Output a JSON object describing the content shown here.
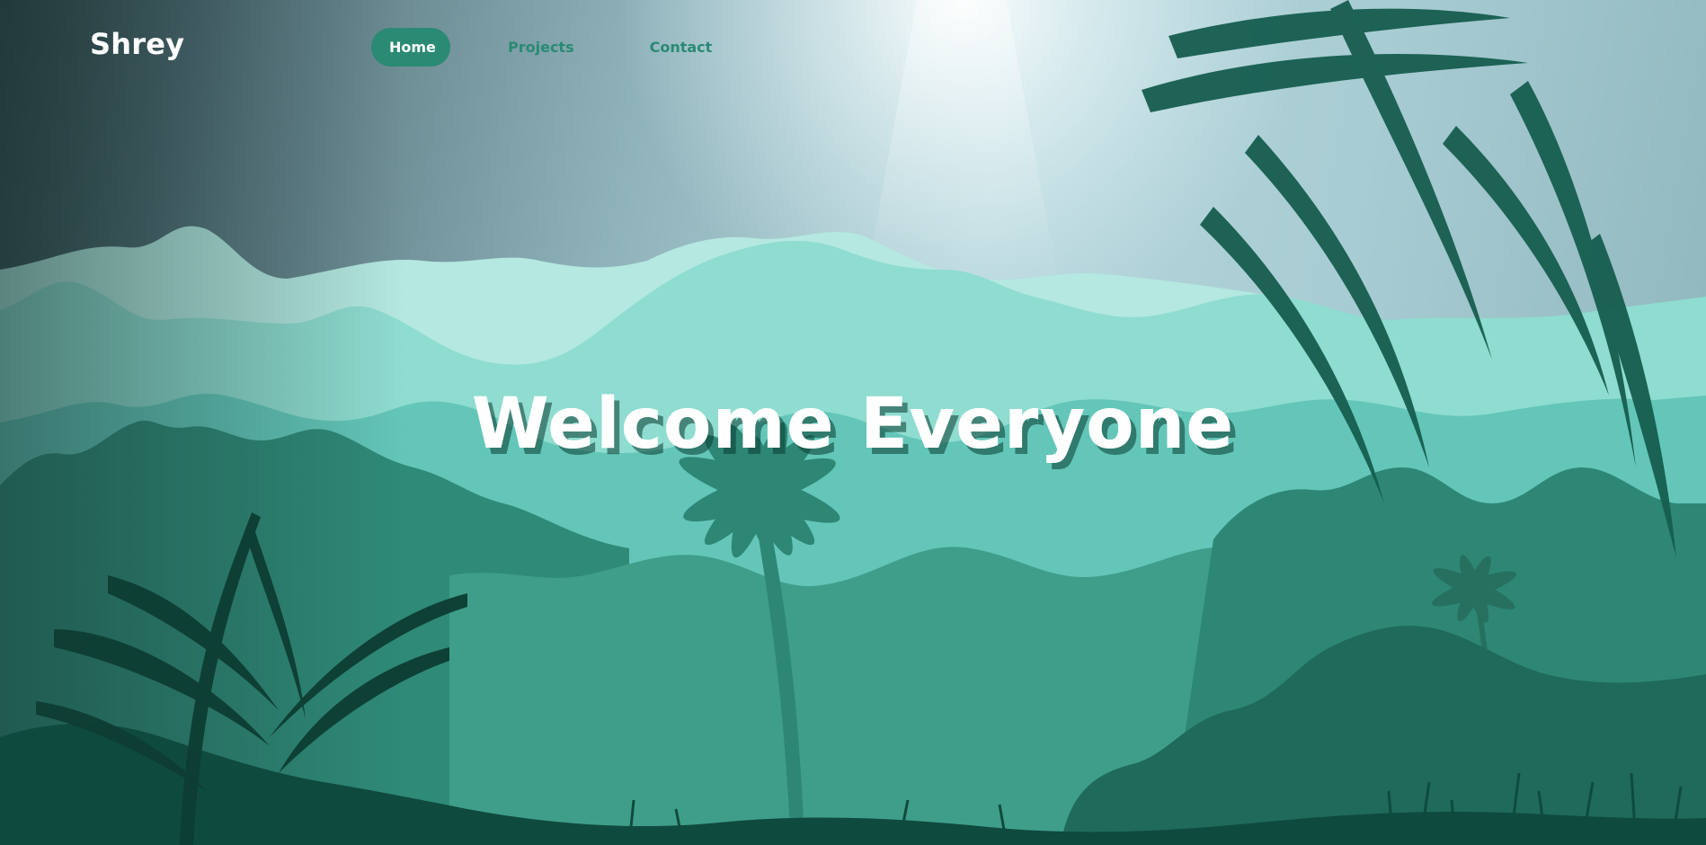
{
  "brand": {
    "name": "Shrey"
  },
  "nav": {
    "items": [
      {
        "label": "Home",
        "active": true
      },
      {
        "label": "Projects",
        "active": false
      },
      {
        "label": "Contact",
        "active": false
      }
    ]
  },
  "hero": {
    "title": "Welcome Everyone"
  },
  "colors": {
    "accent": "#2a8a74",
    "sky_dark": "#2f4248",
    "sky_light": "#b6d6dc",
    "mountain_far": "#b4e8e0",
    "mountain_mid": "#8fdcd0",
    "forest": "#2f8a78",
    "foreground": "#0f4a3e"
  },
  "icons": {
    "background": "jungle-landscape-illustration"
  }
}
